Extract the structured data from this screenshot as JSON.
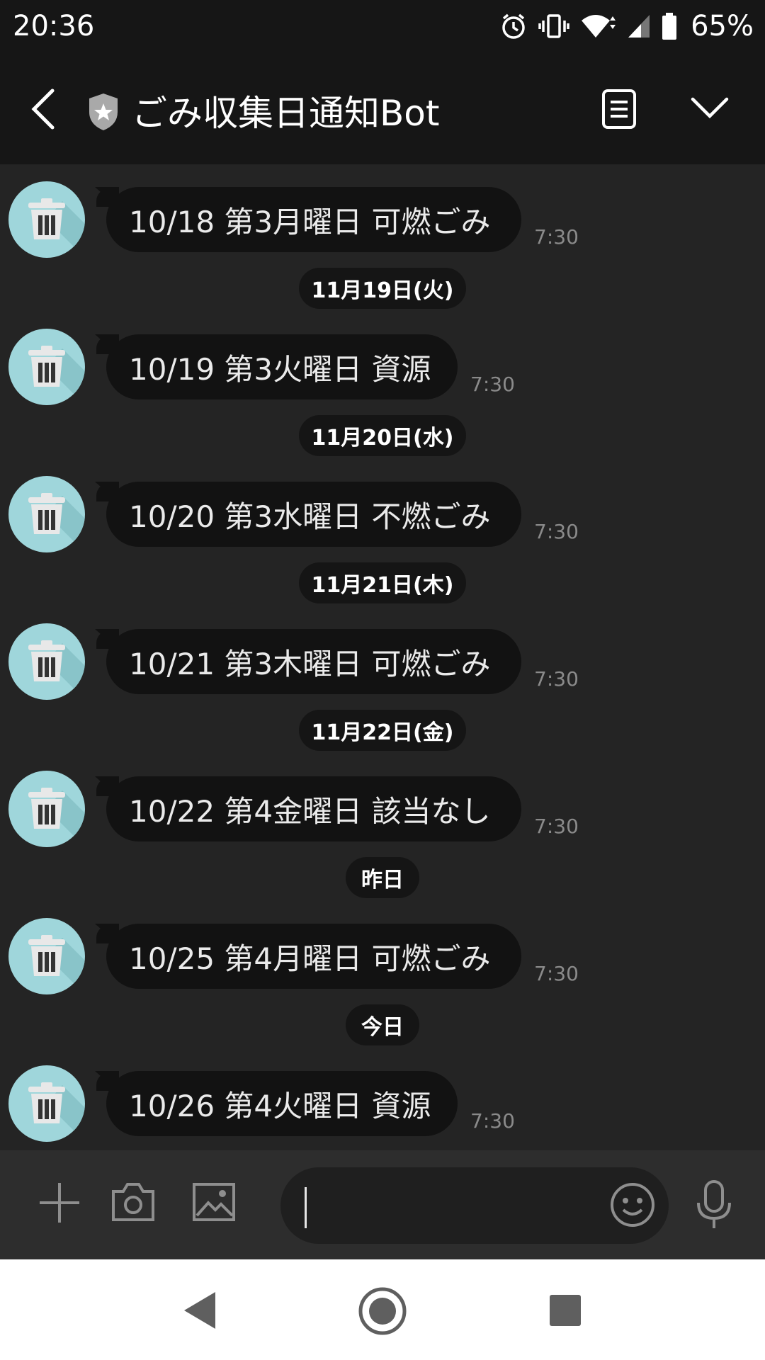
{
  "status": {
    "time": "20:36",
    "battery": "65%"
  },
  "header": {
    "title": "ごみ収集日通知Bot"
  },
  "messages": [
    {
      "text": "10/18 第3月曜日 可燃ごみ",
      "time": "7:30"
    },
    {
      "text": "10/19 第3火曜日 資源",
      "time": "7:30"
    },
    {
      "text": "10/20 第3水曜日 不燃ごみ",
      "time": "7:30"
    },
    {
      "text": "10/21 第3木曜日 可燃ごみ",
      "time": "7:30"
    },
    {
      "text": "10/22 第4金曜日 該当なし",
      "time": "7:30"
    },
    {
      "text": "10/25 第4月曜日 可燃ごみ",
      "time": "7:30"
    },
    {
      "text": "10/26 第4火曜日 資源",
      "time": "7:30"
    }
  ],
  "dates": [
    "11月19日(火)",
    "11月20日(水)",
    "11月21日(木)",
    "11月22日(金)",
    "昨日",
    "今日"
  ],
  "input": {
    "value": "",
    "placeholder": ""
  },
  "colors": {
    "background": "#242424",
    "bubble": "#121212",
    "avatar": "#9fd6db",
    "bar": "#161616"
  }
}
